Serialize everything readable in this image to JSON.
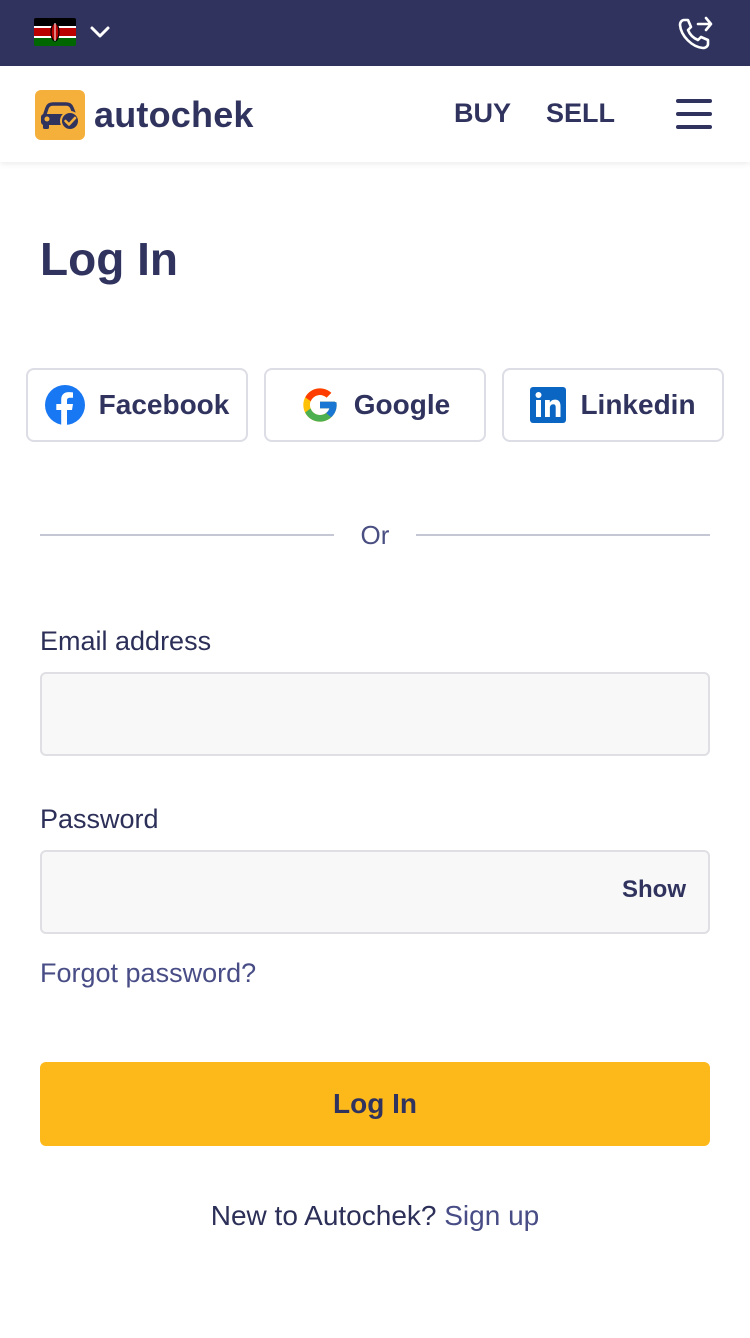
{
  "topbar": {
    "country_flag": "kenya-flag-icon",
    "dropdown_icon": "chevron-down-icon",
    "phone_icon": "phone-forward-icon",
    "colors": {
      "background": "#30335e"
    }
  },
  "navbar": {
    "logo_text": "autochek",
    "logo_icon": "car-check-icon",
    "buy_label": "BUY",
    "sell_label": "SELL",
    "menu_icon": "hamburger-menu-icon"
  },
  "login": {
    "title": "Log In",
    "social": [
      {
        "label": "Facebook",
        "icon": "facebook-icon"
      },
      {
        "label": "Google",
        "icon": "google-icon"
      },
      {
        "label": "Linkedin",
        "icon": "linkedin-icon"
      }
    ],
    "divider_text": "Or",
    "email_label": "Email address",
    "email_value": "",
    "password_label": "Password",
    "password_value": "",
    "show_label": "Show",
    "forgot_label": "Forgot password?",
    "submit_label": "Log In",
    "signup_prompt": "New to Autochek?",
    "signup_link": "Sign up"
  },
  "colors": {
    "primary": "#30335e",
    "accent": "#fdb81a",
    "link": "#484d86"
  }
}
